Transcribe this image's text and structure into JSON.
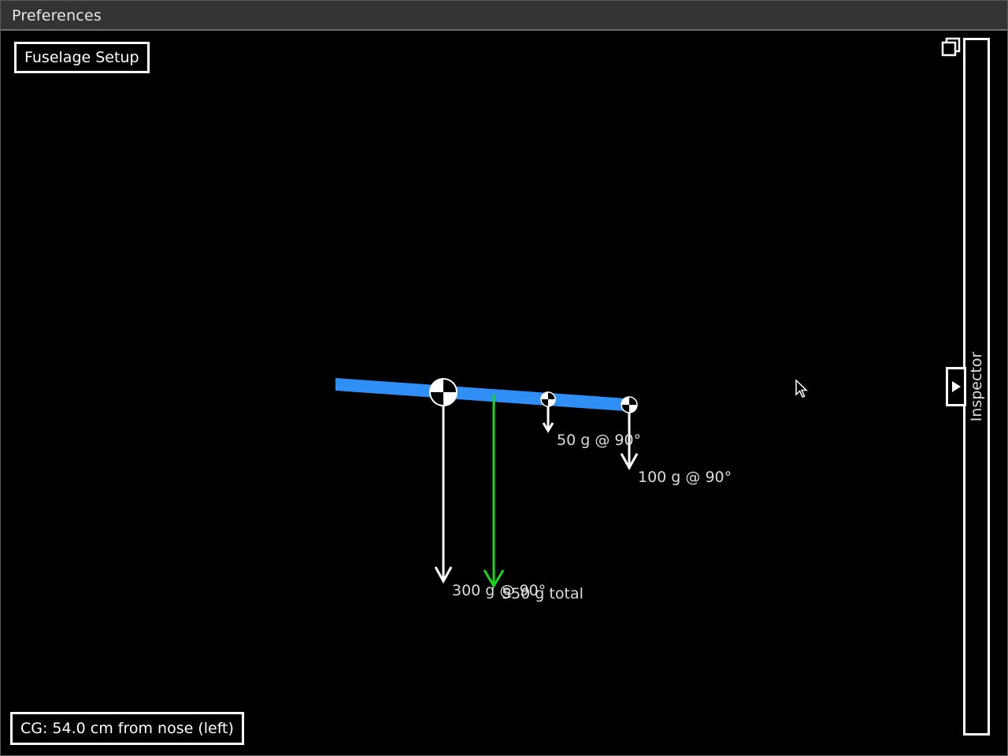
{
  "window": {
    "title": "Preferences"
  },
  "panel": {
    "label": "Fuselage Setup"
  },
  "readout": {
    "cg_text": "CG: 54.0 cm from nose (left)"
  },
  "scene": {
    "masses": [
      {
        "id": "mass-1",
        "label": "300 g @ 90°"
      },
      {
        "id": "mass-2",
        "label": "50 g @ 90°"
      },
      {
        "id": "mass-3",
        "label": "100 g @ 90°"
      }
    ],
    "total_label": "550 g total"
  },
  "inspector": {
    "label": "Inspector"
  },
  "icons": {
    "restore": "restore-window-icon",
    "expand": "chevron-right-icon",
    "cursor": "mouse-cursor-icon",
    "cg_marker": "cg-marker-icon"
  },
  "colors": {
    "fuselage": "#2f8ff5",
    "total_force": "#18d818",
    "force": "#ffffff",
    "background": "#000000",
    "titlebar": "#333333"
  }
}
